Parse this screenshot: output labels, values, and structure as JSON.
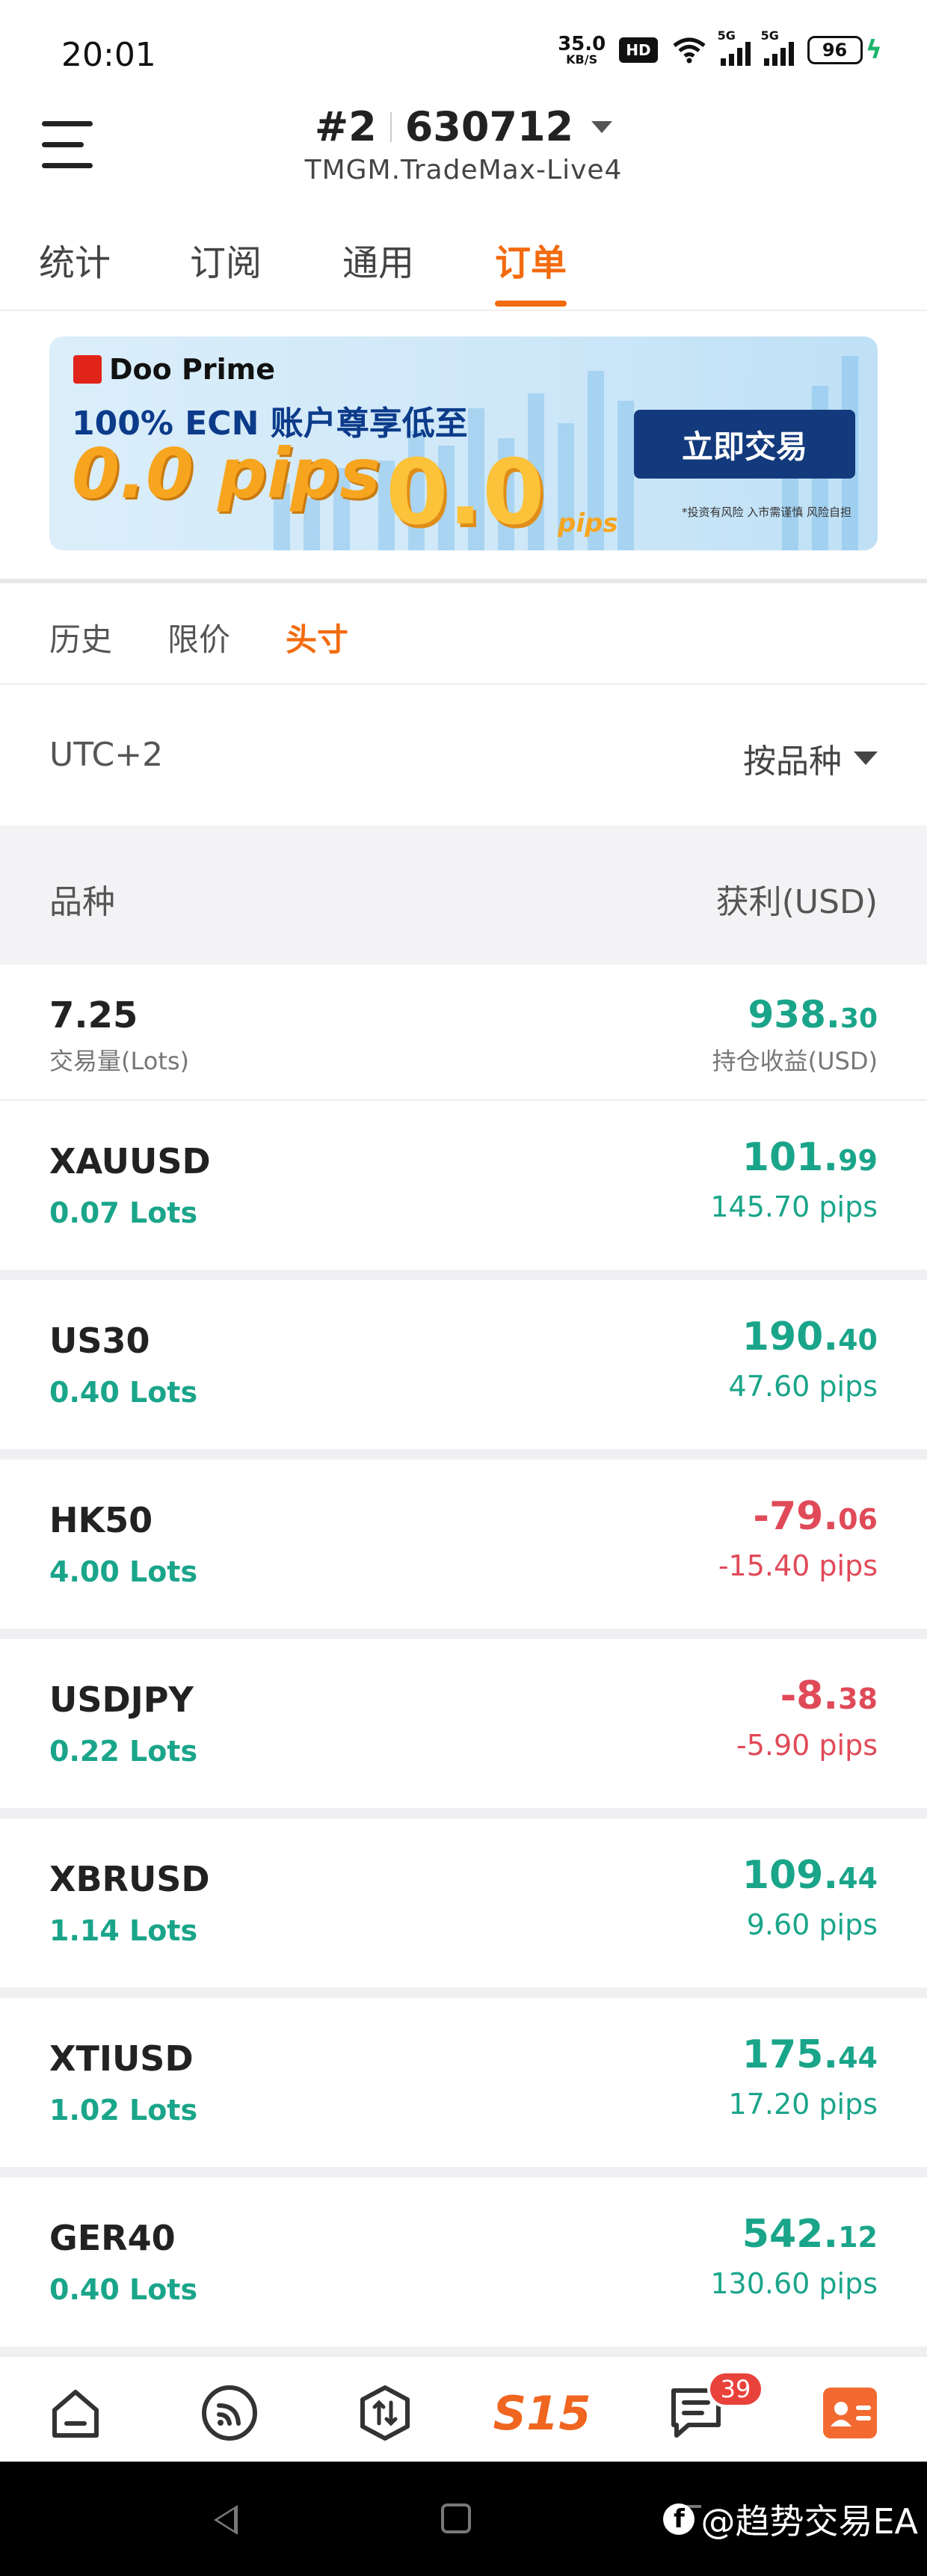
{
  "status_bar": {
    "time": "20:01",
    "net_speed": "35.0",
    "net_unit": "KB/S",
    "hd": "HD",
    "sig1": "5G",
    "sig2": "5G",
    "battery": "96"
  },
  "header": {
    "account_prefix": "#2",
    "account_number": "630712",
    "server": "TMGM.TradeMax-Live4"
  },
  "top_tabs": [
    "统计",
    "订阅",
    "通用",
    "订单"
  ],
  "top_tabs_active": 3,
  "banner": {
    "brand": "Doo Prime",
    "headline": "100% ECN 账户尊享低至",
    "pips_text": "0.0 pips",
    "big_text": "0.0",
    "small_pips": "pips",
    "cta": "立即交易",
    "disclaimer": "*投资有风险 入市需谨慎 风险自担"
  },
  "sub_tabs": [
    "历史",
    "限价",
    "头寸"
  ],
  "sub_tabs_active": 2,
  "filter": {
    "timezone": "UTC+2",
    "sort_label": "按品种"
  },
  "columns": {
    "left": "品种",
    "right": "获利(USD)"
  },
  "summary": {
    "volume": "7.25",
    "volume_label": "交易量(Lots)",
    "profit_main": "938.",
    "profit_cents": "30",
    "profit_label": "持仓收益(USD)"
  },
  "positions": [
    {
      "symbol": "XAUUSD",
      "lots": "0.07 Lots",
      "pl_main": "101.",
      "pl_cents": "99",
      "pips": "145.70 pips",
      "dir": "up"
    },
    {
      "symbol": "US30",
      "lots": "0.40 Lots",
      "pl_main": "190.",
      "pl_cents": "40",
      "pips": "47.60 pips",
      "dir": "up"
    },
    {
      "symbol": "HK50",
      "lots": "4.00 Lots",
      "pl_main": "-79.",
      "pl_cents": "06",
      "pips": "-15.40 pips",
      "dir": "down"
    },
    {
      "symbol": "USDJPY",
      "lots": "0.22 Lots",
      "pl_main": "-8.",
      "pl_cents": "38",
      "pips": "-5.90 pips",
      "dir": "down"
    },
    {
      "symbol": "XBRUSD",
      "lots": "1.14 Lots",
      "pl_main": "109.",
      "pl_cents": "44",
      "pips": "9.60 pips",
      "dir": "up"
    },
    {
      "symbol": "XTIUSD",
      "lots": "1.02 Lots",
      "pl_main": "175.",
      "pl_cents": "44",
      "pips": "17.20 pips",
      "dir": "up"
    },
    {
      "symbol": "GER40",
      "lots": "0.40 Lots",
      "pl_main": "542.",
      "pl_cents": "12",
      "pips": "130.60 pips",
      "dir": "up"
    }
  ],
  "bottom_nav": {
    "icons": [
      "home-icon",
      "signal-feed-icon",
      "trade-icon",
      "s15-logo",
      "messages-icon",
      "profile-card-icon"
    ],
    "logo_text": "S15",
    "badge": "39"
  },
  "watermark": "@趋势交易EA",
  "colors": {
    "accent": "#f26b0f",
    "profit": "#1aa58a",
    "loss": "#e04a58"
  }
}
